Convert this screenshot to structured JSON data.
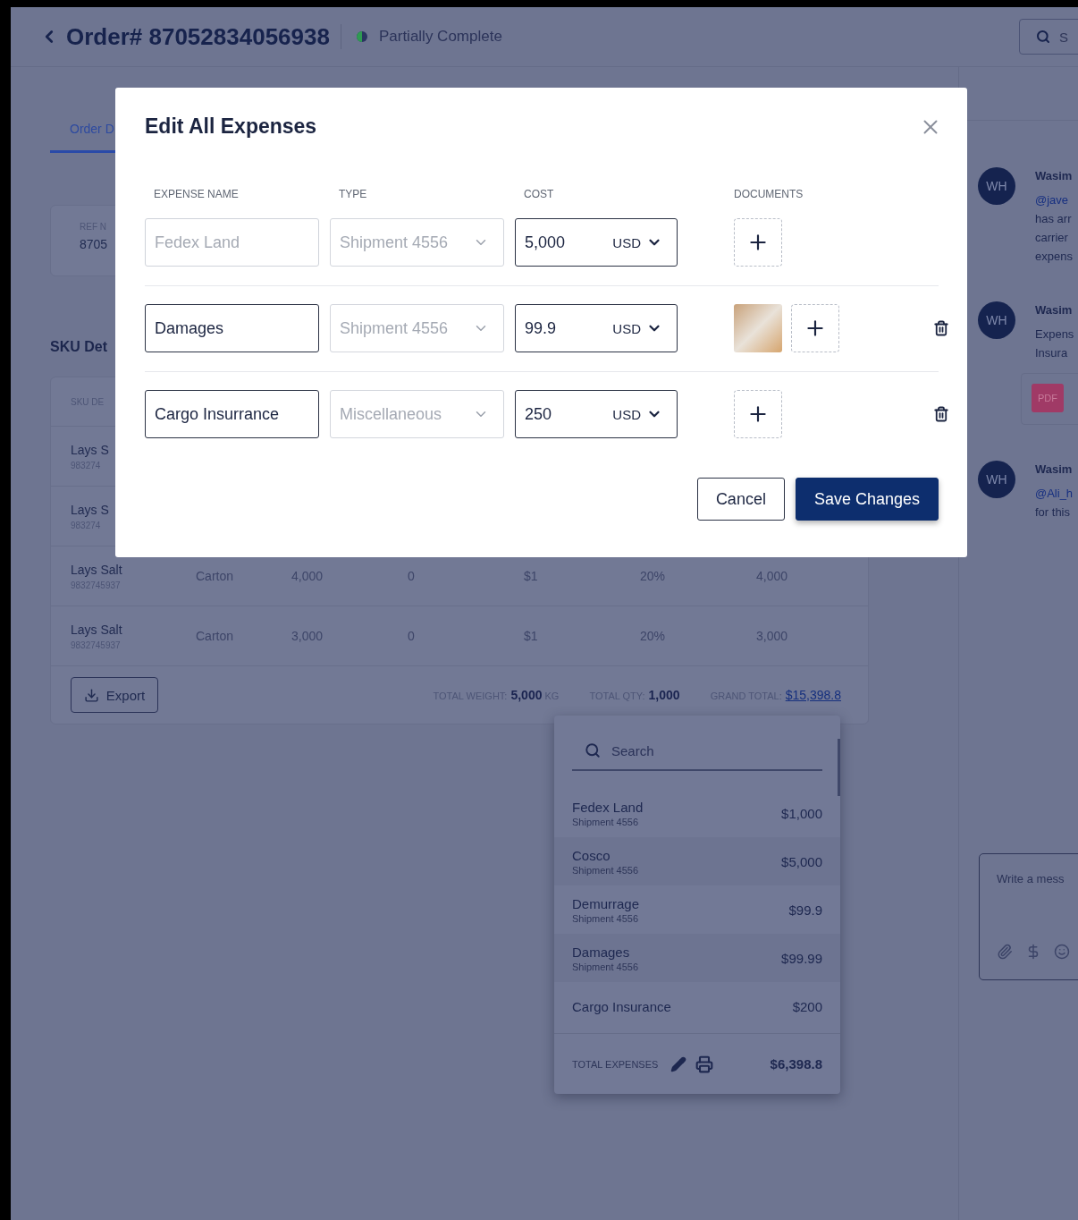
{
  "header": {
    "title": "Order# 87052834056938",
    "status": "Partially Complete",
    "search_placeholder": "S"
  },
  "tabs": [
    {
      "label": "Order D",
      "selected": true
    }
  ],
  "ref_card": {
    "label": "REF N",
    "value": "8705"
  },
  "sku": {
    "title": "SKU Det",
    "column": "SKU DE",
    "rows": [
      {
        "name": "Lays S",
        "code": "983274",
        "cells": []
      },
      {
        "name": "Lays S",
        "code": "983274",
        "cells": []
      },
      {
        "name": "Lays Salt",
        "code": "9832745937",
        "cells": [
          "Carton",
          "4,000",
          "0",
          "$1",
          "20%",
          "4,000"
        ]
      },
      {
        "name": "Lays Salt",
        "code": "9832745937",
        "cells": [
          "Carton",
          "3,000",
          "0",
          "$1",
          "20%",
          "3,000"
        ]
      }
    ],
    "export": "Export",
    "totals": [
      {
        "label": "TOTAL WEIGHT:",
        "value": "5,000",
        "unit": "KG",
        "kind": "plain"
      },
      {
        "label": "TOTAL QTY:",
        "value": "1,000",
        "kind": "plain"
      },
      {
        "label": "GRAND TOTAL:",
        "value": "$15,398.8",
        "kind": "link"
      }
    ]
  },
  "modal": {
    "title": "Edit All Expenses",
    "columns": [
      "EXPENSE NAME",
      "TYPE",
      "COST",
      "DOCUMENTS"
    ],
    "rows": [
      {
        "name": "Fedex Land",
        "name_disabled": true,
        "type": "Shipment 4556",
        "cost": "5,000",
        "currency": "USD",
        "documents": [],
        "deletable": false
      },
      {
        "name": "Damages",
        "name_disabled": false,
        "type": "Shipment 4556",
        "cost": "99.9",
        "currency": "USD",
        "documents": [
          {
            "kind": "image"
          }
        ],
        "deletable": true
      },
      {
        "name": "Cargo Insurrance",
        "name_disabled": false,
        "type": "Miscellaneous",
        "cost": "250",
        "currency": "USD",
        "documents": [],
        "deletable": true
      }
    ],
    "buttons": [
      {
        "label": "Cancel",
        "kind": "secondary"
      },
      {
        "label": "Save Changes",
        "kind": "primary"
      }
    ]
  },
  "expenses_popover": {
    "search_placeholder": "Search",
    "items": [
      {
        "name": "Fedex Land",
        "sub": "Shipment 4556",
        "amount": "$1,000"
      },
      {
        "name": "Cosco",
        "sub": "Shipment 4556",
        "amount": "$5,000"
      },
      {
        "name": "Demurrage",
        "sub": "Shipment 4556",
        "amount": "$99.9"
      },
      {
        "name": "Damages",
        "sub": "Shipment 4556",
        "amount": "$99.99"
      },
      {
        "name": "Cargo Insurance",
        "amount": "$200"
      }
    ],
    "total_label": "TOTAL EXPENSES",
    "total": "$6,398.8"
  },
  "chat": {
    "messages": [
      {
        "avatar": "WH",
        "author": "Wasim",
        "lines": [
          {
            "text": "@jave",
            "kind": "mention"
          },
          {
            "text": "has arr",
            "kind": "plain"
          },
          {
            "text": "carrier",
            "kind": "plain"
          },
          {
            "text": "expens",
            "kind": "plain"
          }
        ]
      },
      {
        "avatar": "WH",
        "author": "Wasim",
        "lines": [
          {
            "text": "Expens",
            "kind": "plain"
          },
          {
            "text": "Insura",
            "kind": "plain"
          }
        ],
        "attachment": "PDF"
      },
      {
        "avatar": "WH",
        "author": "Wasim",
        "lines": [
          {
            "text": "@Ali_h",
            "kind": "mention"
          },
          {
            "text": "for this",
            "kind": "plain"
          }
        ]
      }
    ],
    "composer_placeholder": "Write a mess"
  }
}
